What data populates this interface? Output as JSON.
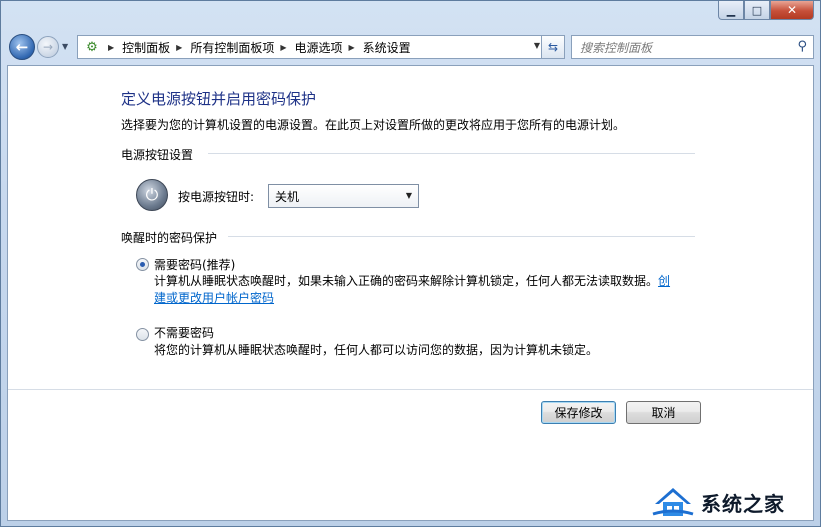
{
  "window": {
    "caption": {
      "minimize": "▁",
      "maximize": "□",
      "close": "✕"
    }
  },
  "nav": {
    "back_icon": "arrow-left-icon",
    "forward_icon": "arrow-right-icon",
    "crumbs": [
      "控制面板",
      "所有控制面板项",
      "电源选项",
      "系统设置"
    ],
    "search_placeholder": "搜索控制面板"
  },
  "main": {
    "title": "定义电源按钮并启用密码保护",
    "description": "选择要为您的计算机设置的电源设置。在此页上对设置所做的更改将应用于您所有的电源计划。",
    "power_section": {
      "header": "电源按钮设置",
      "label": "按电源按钮时:",
      "selected": "关机"
    },
    "password_section": {
      "header": "唤醒时的密码保护",
      "options": [
        {
          "label": "需要密码(推荐)",
          "checked": true,
          "desc_line1": "计算机从睡眠状态唤醒时，如果未输入正确的密码来解除计算机锁定，任何人都无法读取数据。",
          "link_part1": "创",
          "link_part2": "建或更改用户帐户密码"
        },
        {
          "label": "不需要密码",
          "checked": false,
          "desc": "将您的计算机从睡眠状态唤醒时，任何人都可以访问您的数据，因为计算机未锁定。"
        }
      ]
    },
    "buttons": {
      "save": "保存修改",
      "cancel": "取消"
    }
  },
  "watermark": {
    "text": "系统之家"
  }
}
